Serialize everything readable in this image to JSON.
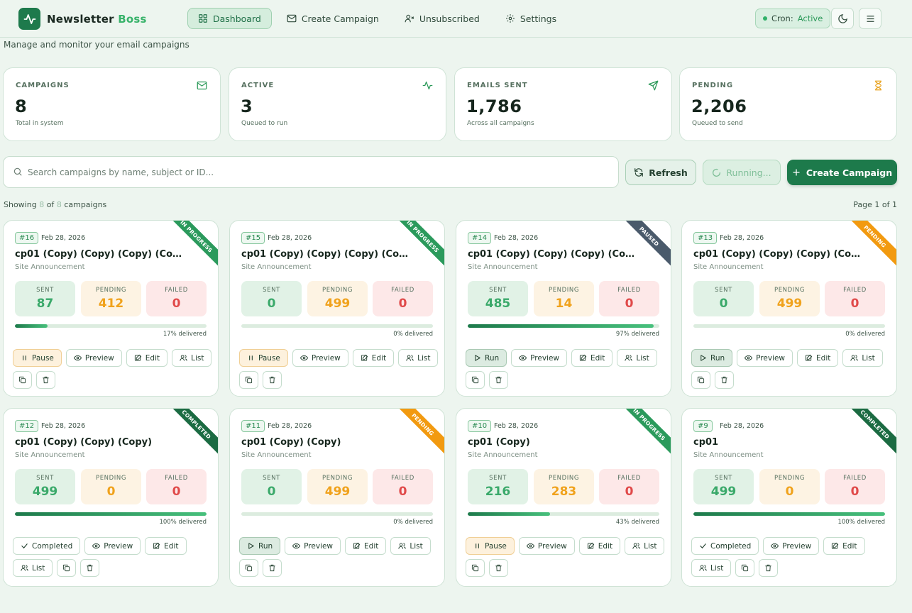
{
  "brand": {
    "name_a": "Newsletter",
    "name_b": "Boss"
  },
  "nav": [
    {
      "label": "Dashboard",
      "icon": "grid-icon",
      "active": true
    },
    {
      "label": "Create Campaign",
      "icon": "mail-icon",
      "active": false
    },
    {
      "label": "Unsubscribed",
      "icon": "user-x-icon",
      "active": false
    },
    {
      "label": "Settings",
      "icon": "gear-icon",
      "active": false
    }
  ],
  "cron": {
    "label": "Cron:",
    "value": "Active"
  },
  "subtitle": "Manage and monitor your email campaigns",
  "stats": [
    {
      "label": "CAMPAIGNS",
      "value": "8",
      "sub": "Total in system",
      "icon": "mail-icon"
    },
    {
      "label": "ACTIVE",
      "value": "3",
      "sub": "Queued to run",
      "icon": "activity-icon"
    },
    {
      "label": "EMAILS SENT",
      "value": "1,786",
      "sub": "Across all campaigns",
      "icon": "send-icon"
    },
    {
      "label": "PENDING",
      "value": "2,206",
      "sub": "Queued to send",
      "icon": "hourglass-icon"
    }
  ],
  "search": {
    "placeholder": "Search campaigns by name, subject or ID..."
  },
  "toolbar": {
    "refresh": "Refresh",
    "running": "Running...",
    "create": "Create Campaign"
  },
  "showing": {
    "prefix": "Showing",
    "count": "8",
    "of": "of",
    "total": "8",
    "suffix": "campaigns"
  },
  "page_info": "Page 1 of 1",
  "labels": {
    "sent": "SENT",
    "pending": "PENDING",
    "failed": "FAILED",
    "delivered_suffix": "delivered"
  },
  "campaigns": [
    {
      "id": "#16",
      "date": "Feb 28, 2026",
      "title": "cp01 (Copy) (Copy) (Copy) (Cop...",
      "type": "Site Announcement",
      "status": "IN PROGRESS",
      "sent": "87",
      "pending": "412",
      "failed": "0",
      "progress": 0.17,
      "delivered": "17% delivered",
      "primary": "Pause",
      "actions": [
        "Preview",
        "Edit",
        "List"
      ]
    },
    {
      "id": "#15",
      "date": "Feb 28, 2026",
      "title": "cp01 (Copy) (Copy) (Copy) (Cop...",
      "type": "Site Announcement",
      "status": "IN PROGRESS",
      "sent": "0",
      "pending": "499",
      "failed": "0",
      "progress": 0.0,
      "delivered": "0% delivered",
      "primary": "Pause",
      "actions": [
        "Preview",
        "Edit",
        "List"
      ]
    },
    {
      "id": "#14",
      "date": "Feb 28, 2026",
      "title": "cp01 (Copy) (Copy) (Copy) (Cop...",
      "type": "Site Announcement",
      "status": "PAUSED",
      "sent": "485",
      "pending": "14",
      "failed": "0",
      "progress": 0.97,
      "delivered": "97% delivered",
      "primary": "Run",
      "actions": [
        "Preview",
        "Edit",
        "List"
      ]
    },
    {
      "id": "#13",
      "date": "Feb 28, 2026",
      "title": "cp01 (Copy) (Copy) (Copy) (Cop...",
      "type": "Site Announcement",
      "status": "PENDING",
      "sent": "0",
      "pending": "499",
      "failed": "0",
      "progress": 0.0,
      "delivered": "0% delivered",
      "primary": "Run",
      "actions": [
        "Preview",
        "Edit",
        "List"
      ]
    },
    {
      "id": "#12",
      "date": "Feb 28, 2026",
      "title": "cp01 (Copy) (Copy) (Copy)",
      "type": "Site Announcement",
      "status": "COMPLETED",
      "sent": "499",
      "pending": "0",
      "failed": "0",
      "progress": 1.0,
      "delivered": "100% delivered",
      "primary": "Completed",
      "actions": [
        "Preview",
        "Edit",
        "List"
      ]
    },
    {
      "id": "#11",
      "date": "Feb 28, 2026",
      "title": "cp01 (Copy) (Copy)",
      "type": "Site Announcement",
      "status": "PENDING",
      "sent": "0",
      "pending": "499",
      "failed": "0",
      "progress": 0.0,
      "delivered": "0% delivered",
      "primary": "Run",
      "actions": [
        "Preview",
        "Edit",
        "List"
      ]
    },
    {
      "id": "#10",
      "date": "Feb 28, 2026",
      "title": "cp01 (Copy)",
      "type": "Site Announcement",
      "status": "IN PROGRESS",
      "sent": "216",
      "pending": "283",
      "failed": "0",
      "progress": 0.43,
      "delivered": "43% delivered",
      "primary": "Pause",
      "actions": [
        "Preview",
        "Edit",
        "List"
      ]
    },
    {
      "id": "#9",
      "date": "Feb 28, 2026",
      "title": "cp01",
      "type": "Site Announcement",
      "status": "COMPLETED",
      "sent": "499",
      "pending": "0",
      "failed": "0",
      "progress": 1.0,
      "delivered": "100% delivered",
      "primary": "Completed",
      "actions": [
        "Preview",
        "Edit",
        "List"
      ]
    }
  ]
}
